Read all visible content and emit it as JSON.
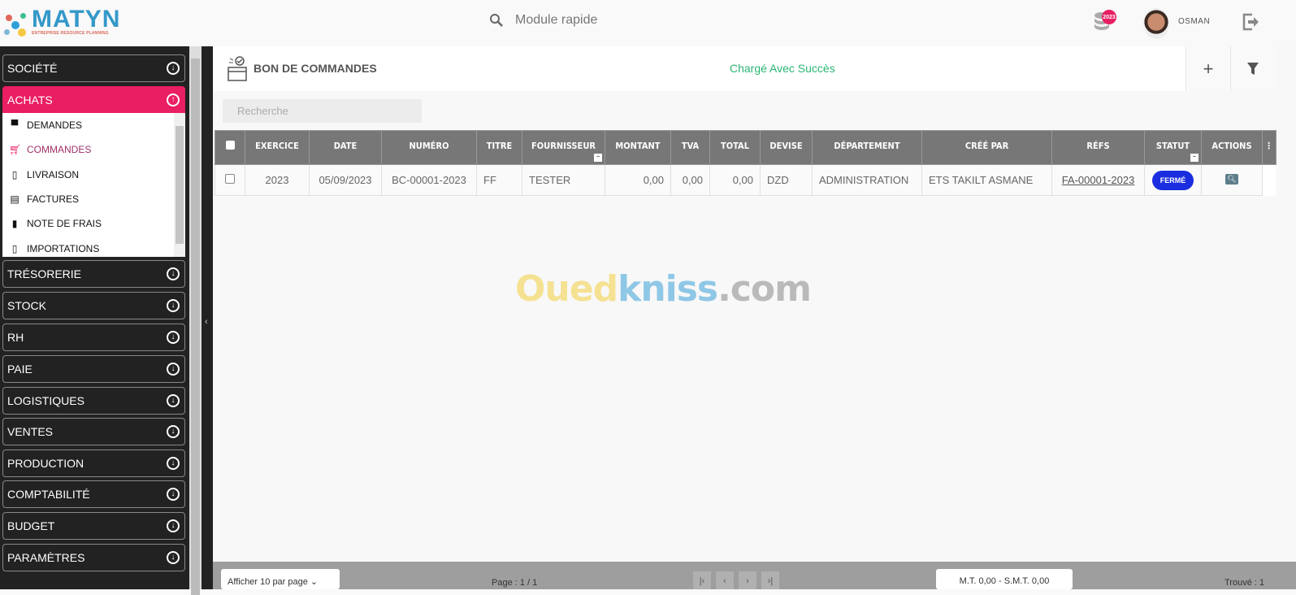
{
  "header": {
    "brand": "MATYN",
    "brand_sub": "ENTREPRISE RESOURCE PLANNING",
    "search_placeholder": "Module rapide",
    "year_badge": "2023",
    "user_name": "OSMAN"
  },
  "sidebar": {
    "items": [
      {
        "label": "SOCIÉTÉ"
      },
      {
        "label": "ACHATS",
        "active": true
      },
      {
        "label": "TRÉSORERIE"
      },
      {
        "label": "STOCK"
      },
      {
        "label": "RH"
      },
      {
        "label": "PAIE"
      },
      {
        "label": "LOGISTIQUES"
      },
      {
        "label": "VENTES"
      },
      {
        "label": "PRODUCTION"
      },
      {
        "label": "COMPTABILITÉ"
      },
      {
        "label": "BUDGET"
      },
      {
        "label": "PARAMÈTRES"
      }
    ],
    "submenu": [
      {
        "label": "DEMANDES",
        "icon": "store-icon"
      },
      {
        "label": "COMMANDES",
        "icon": "cart-icon",
        "current": true
      },
      {
        "label": "LIVRAISON",
        "icon": "clipboard-icon"
      },
      {
        "label": "FACTURES",
        "icon": "list-icon"
      },
      {
        "label": "NOTE DE FRAIS",
        "icon": "document-icon"
      },
      {
        "label": "IMPORTATIONS",
        "icon": "clipboard-icon"
      }
    ]
  },
  "page": {
    "title": "BON DE COMMANDES",
    "status_message": "Chargé Avec Succès",
    "add_label": "+",
    "search_placeholder": "Recherche"
  },
  "table": {
    "columns": [
      "EXERCICE",
      "DATE",
      "NUMÉRO",
      "TITRE",
      "FOURNISSEUR",
      "MONTANT",
      "TVA",
      "TOTAL",
      "DEVISE",
      "DÉPARTEMENT",
      "CRÉÉ PAR",
      "RÉFS",
      "STATUT",
      "ACTIONS"
    ],
    "rows": [
      {
        "exercice": "2023",
        "date": "05/09/2023",
        "numero": "BC-00001-2023",
        "titre": "FF",
        "fournisseur": "TESTER",
        "montant": "0,00",
        "tva": "0,00",
        "total": "0,00",
        "devise": "DZD",
        "departement": "ADMINISTRATION",
        "cree_par": "ETS TAKILT ASMANE",
        "refs": "FA-00001-2023",
        "statut": "FERMÉ"
      }
    ]
  },
  "footer": {
    "per_page": "Afficher 10 par page",
    "page_info": "Page : 1 / 1",
    "totals": "M.T. 0,00 - S.M.T. 0,00",
    "found": "Trouvé : 1"
  },
  "watermark": "Ouedkniss.com",
  "colors": {
    "accent": "#e91e63",
    "success": "#2bb673",
    "status_closed": "#1a2ee0",
    "brand": "#3498c9"
  }
}
